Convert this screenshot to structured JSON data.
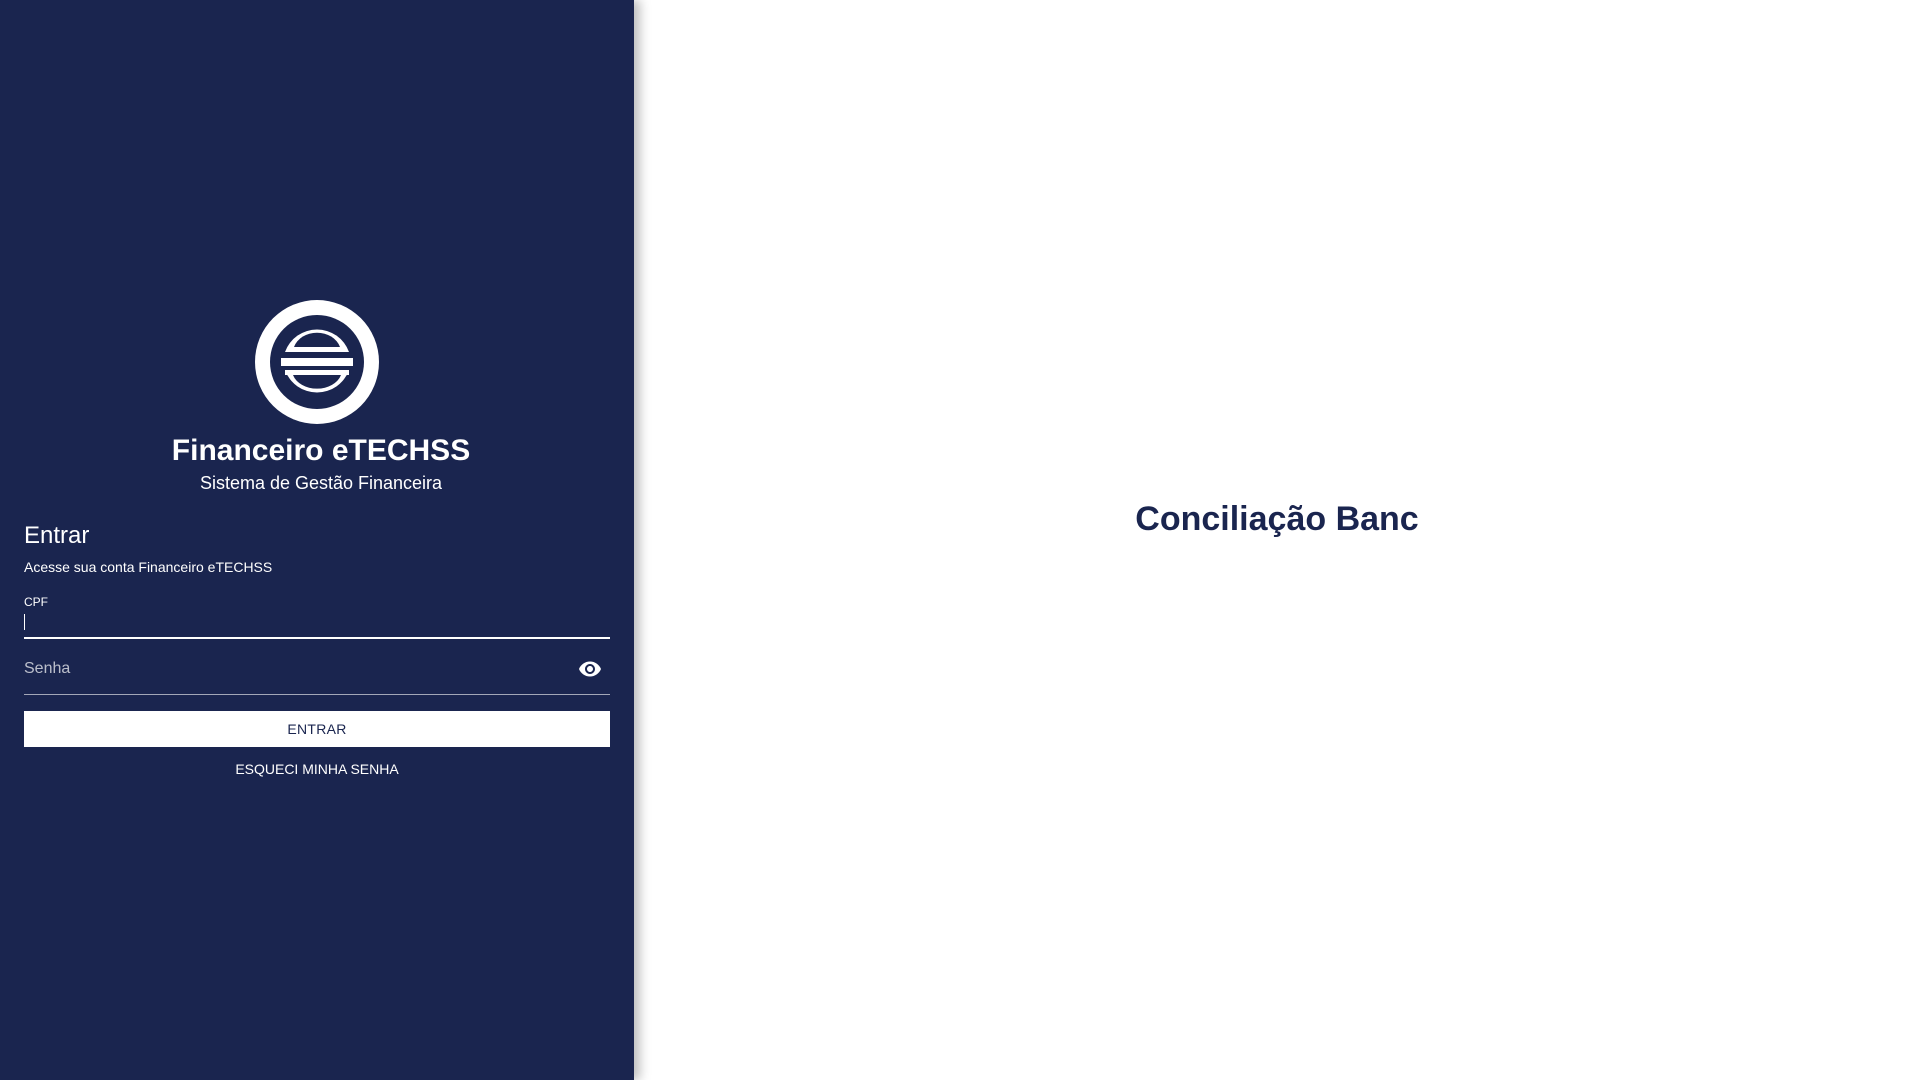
{
  "brand": {
    "title": "Financeiro eTECHSS",
    "subtitle": "Sistema de Gestão Financeira",
    "logo_icon": "etechss-logo-icon"
  },
  "login": {
    "title": "Entrar",
    "description": "Acesse sua conta Financeiro eTECHSS",
    "cpf_label": "CPF",
    "cpf_value": "",
    "password_placeholder": "Senha",
    "password_value": "",
    "visibility_icon": "eye-icon",
    "submit_label": "ENTRAR",
    "forgot_label": "ESQUECI MINHA SENHA"
  },
  "hero": {
    "text": "Conciliação Banc"
  },
  "colors": {
    "primary": "#1a254f",
    "background": "#ffffff",
    "text_on_primary": "#ffffff"
  }
}
